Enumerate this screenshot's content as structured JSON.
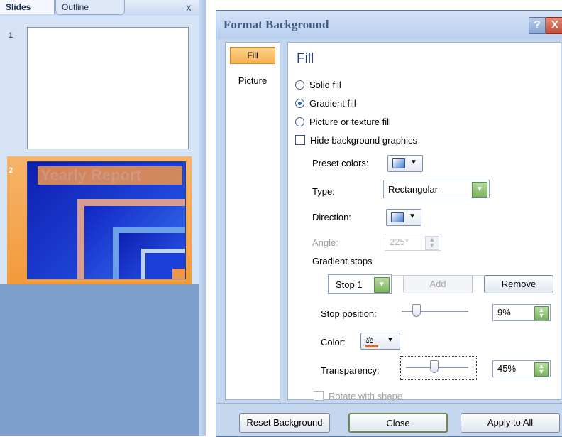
{
  "left_pane": {
    "tab_slides": "Slides",
    "tab_outline": "Outline",
    "close_glyph": "x",
    "slides": [
      {
        "number": "1"
      },
      {
        "number": "2",
        "title": "Yearly Report"
      }
    ]
  },
  "dialog": {
    "title": "Format Background",
    "help_label": "?",
    "close_label": "X",
    "nav": {
      "fill": "Fill",
      "picture": "Picture"
    },
    "heading": "Fill",
    "options": {
      "solid_fill": "Solid fill",
      "gradient_fill": "Gradient fill",
      "picture_texture_fill": "Picture or texture fill",
      "hide_background_graphics": "Hide background graphics",
      "selected": "gradient_fill"
    },
    "preset_colors_label": "Preset colors:",
    "type_label": "Type:",
    "type_value": "Rectangular",
    "direction_label": "Direction:",
    "angle_label": "Angle:",
    "angle_value": "225°",
    "gradient_stops_label": "Gradient stops",
    "stop_select_value": "Stop 1",
    "add_button": "Add",
    "remove_button": "Remove",
    "stop_position_label": "Stop position:",
    "stop_position_value": "9%",
    "stop_position_level": 0.09,
    "color_label": "Color:",
    "transparency_label": "Transparency:",
    "transparency_value": "45%",
    "transparency_level": 0.45,
    "rotate_with_shape": "Rotate with shape",
    "reset_button": "Reset Background",
    "close_button": "Close",
    "apply_all_button": "Apply to All"
  },
  "colors": {
    "accent_orange": "#f7b14f",
    "slide_blue": "#1b3fd8",
    "dialog_bg": "#c5d7ef"
  },
  "icons": {
    "help": "help-icon",
    "close": "close-icon",
    "dropdown": "chevron-down-icon",
    "paint_bucket": "paint-bucket-icon"
  }
}
